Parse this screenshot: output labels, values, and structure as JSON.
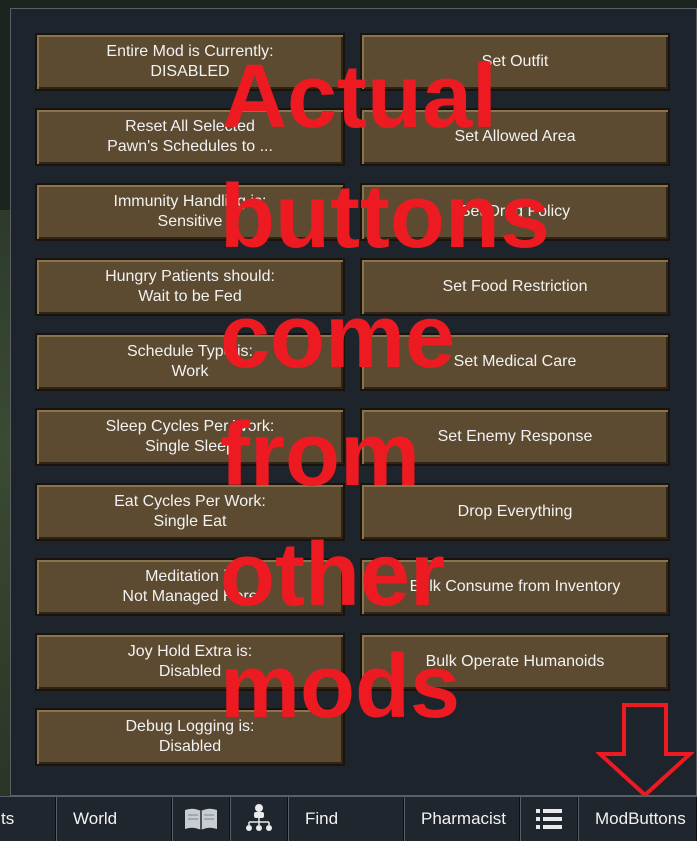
{
  "left_buttons": [
    {
      "line1": "Entire Mod is Currently:",
      "line2": "DISABLED"
    },
    {
      "line1": "Reset All Selected",
      "line2": "Pawn's Schedules to ..."
    },
    {
      "line1": "Immunity Handling is:",
      "line2": "Sensitive"
    },
    {
      "line1": "Hungry Patients should:",
      "line2": "Wait to be Fed"
    },
    {
      "line1": "Schedule Type is:",
      "line2": "Work"
    },
    {
      "line1": "Sleep Cycles Per Work:",
      "line2": "Single Sleep"
    },
    {
      "line1": "Eat Cycles Per Work:",
      "line2": "Single Eat"
    },
    {
      "line1": "Meditation is",
      "line2": "Not Managed Here"
    },
    {
      "line1": "Joy Hold Extra is:",
      "line2": "Disabled"
    },
    {
      "line1": "Debug Logging is:",
      "line2": "Disabled"
    }
  ],
  "right_buttons": [
    "Set Outfit",
    "Set Allowed Area",
    "Set Drug Policy",
    "Set Food Restriction",
    "Set Medical Care",
    "Set Enemy Response",
    "Drop Everything",
    "Bulk Consume from Inventory",
    "Bulk Operate Humanoids"
  ],
  "overlay": {
    "lines": [
      "Actual",
      "buttons",
      "come",
      "from",
      "other",
      "mods"
    ],
    "color": "#ee1a22"
  },
  "bottom_bar": {
    "tab_partial": "ts",
    "tab_world": "World",
    "tab_book_icon": "book-icon",
    "tab_hierarchy_icon": "hierarchy-icon",
    "tab_find": "Find",
    "tab_pharmacist": "Pharmacist",
    "tab_list_icon": "list-icon",
    "tab_modbuttons": "ModButtons"
  },
  "colors": {
    "button_bg": "#5c4a31",
    "panel_bg": "#1d242b"
  }
}
